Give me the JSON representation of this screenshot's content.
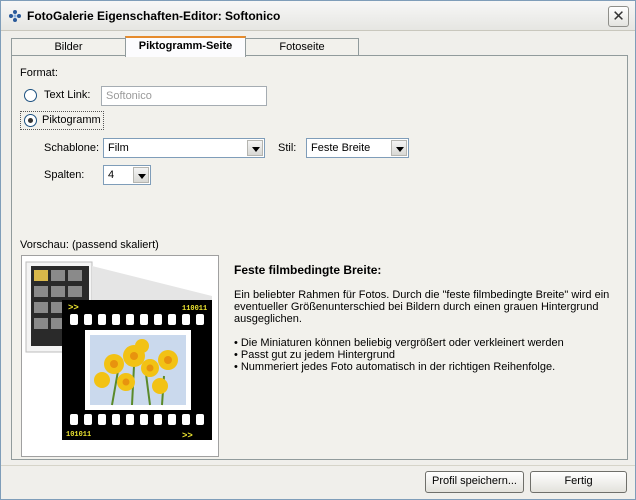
{
  "window": {
    "title": "FotoGalerie Eigenschaften-Editor: Softonico",
    "close_symbol": "✕"
  },
  "tabs": [
    {
      "label": "Bilder",
      "active": false
    },
    {
      "label": "Piktogramm-Seite",
      "active": true
    },
    {
      "label": "Fotoseite",
      "active": false
    }
  ],
  "format": {
    "label": "Format:",
    "text_link": {
      "label": "Text Link:",
      "value": "Softonico",
      "selected": false
    },
    "piktogramm": {
      "label": "Piktogramm",
      "selected": true
    }
  },
  "options": {
    "schablone_label": "Schablone:",
    "schablone_value": "Film",
    "stil_label": "Stil:",
    "stil_value": "Feste Breite",
    "spalten_label": "Spalten:",
    "spalten_value": "4"
  },
  "preview": {
    "label": "Vorschau: (passend skaliert)",
    "arrows": ">>",
    "frame_code_top": "110011",
    "frame_code_bottom": "101011"
  },
  "description": {
    "title": "Feste filmbedingte Breite:",
    "paragraph": "Ein beliebter Rahmen für Fotos. Durch die \"feste filmbedingte Breite\" wird ein eventueller Größenunterschied bei Bildern durch einen grauen Hintergrund ausgeglichen.",
    "bullets": [
      "Die Miniaturen können beliebig vergrößert oder verkleinert werden",
      "Passt gut zu jedem Hintergrund",
      "Nummeriert jedes Foto automatisch in der richtigen Reihenfolge."
    ]
  },
  "footer": {
    "save_profile_label": "Profil speichern...",
    "done_label": "Fertig"
  }
}
